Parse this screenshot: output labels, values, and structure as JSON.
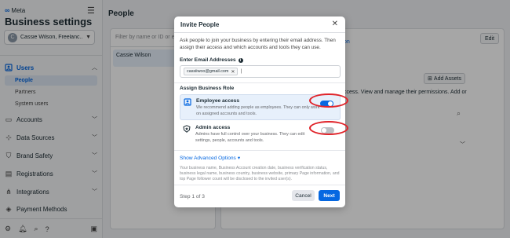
{
  "brand": {
    "name": "Meta",
    "logo_glyph": "∞"
  },
  "app_title": "Business settings",
  "account": {
    "initial": "C",
    "name": "Cassie Wilson, Freelanc..."
  },
  "nav": {
    "users": {
      "label": "Users",
      "icon": "users-icon"
    },
    "users_sub": [
      "People",
      "Partners",
      "System users"
    ],
    "accounts": "Accounts",
    "data_sources": "Data Sources",
    "brand_safety": "Brand Safety",
    "registrations": "Registrations",
    "integrations": "Integrations",
    "payment_methods": "Payment Methods"
  },
  "main": {
    "title": "People",
    "filter_placeholder": "Filter by name or ID or email",
    "people": [
      "Cassie Wilson"
    ],
    "edit_label": "Edit",
    "add_assets_label": "Add Assets",
    "bg_link": "on",
    "bg_desc": "ccess. View and manage their permissions. Add or"
  },
  "modal": {
    "title": "Invite People",
    "intro": "Ask people to join your business by entering their email address. Then assign their access and which accounts and tools they can use.",
    "email_label": "Enter Email Addresses",
    "email_chip": "cassiiwoo@gmail.com",
    "role_label": "Assign Business Role",
    "roles": [
      {
        "title": "Employee access",
        "desc": "We recommend adding people as employees. They can only work on assigned accounts and tools.",
        "enabled": true
      },
      {
        "title": "Admin access",
        "desc": "Admins have full control over your business. They can edit settings, people, accounts and tools.",
        "enabled": false
      }
    ],
    "advanced_label": "Show Advanced Options",
    "notice": "Your business name, Business Account creation date, business verification status, business legal name, business country, business website, primary Page information, and top Page follower count will be disclosed to the invited user(s).",
    "step": "Step 1 of 3",
    "cancel_label": "Cancel",
    "next_label": "Next"
  },
  "colors": {
    "accent": "#0668e1",
    "highlight": "#e0242a"
  }
}
